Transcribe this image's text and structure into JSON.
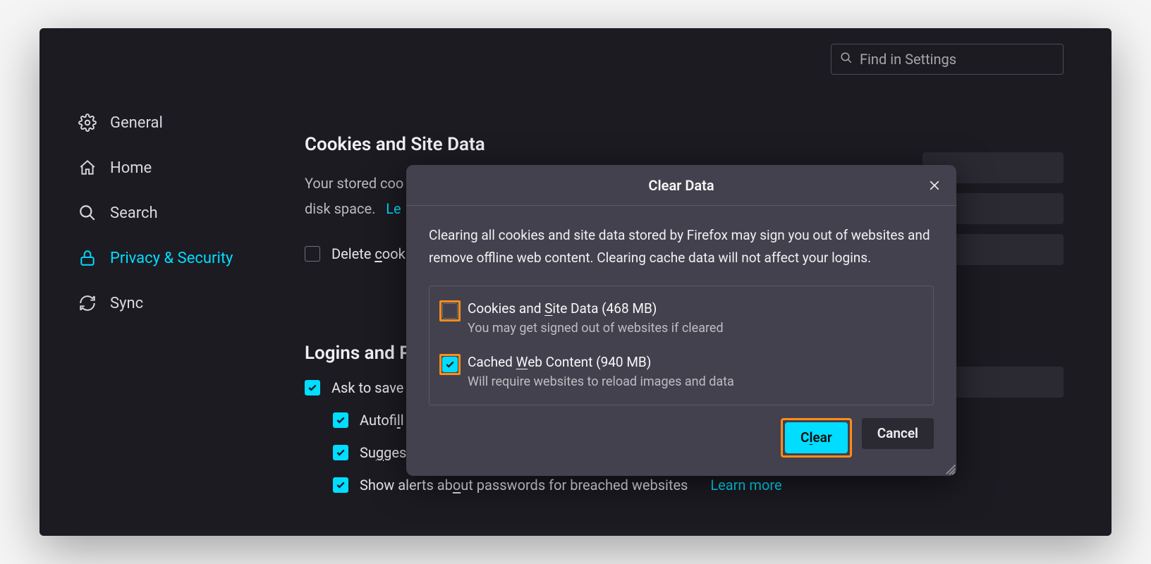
{
  "search": {
    "placeholder": "Find in Settings"
  },
  "sidebar": {
    "general": "General",
    "home": "Home",
    "search": "Search",
    "privacy": "Privacy & Security",
    "sync": "Sync"
  },
  "content": {
    "cookies_heading": "Cookies and Site Data",
    "cookies_body_part1": "Your stored coo",
    "cookies_body_part2": "disk space.",
    "cookies_body_link": "Le",
    "delete_cookies_label_part": "Delete cook",
    "delete_cookies_underline": "c",
    "logins_heading_part": "Logins and P",
    "ask_save_label_part": "Ask to save",
    "autofill_label_pre": "Autofi",
    "autofill_label_underline": "l",
    "autofill_label_post": "l",
    "suggest_label_pre": "Su",
    "suggest_label_underline": "g",
    "suggest_label_post": "gest",
    "breached_label_pre": "Show alerts ab",
    "breached_label_underline": "o",
    "breached_label_post": "ut passwords for breached websites",
    "learn_more": "Learn more"
  },
  "modal": {
    "title": "Clear Data",
    "description": "Clearing all cookies and site data stored by Firefox may sign you out of websites and remove offline web content. Clearing cache data will not affect your logins.",
    "option1_pre": "Cookies and ",
    "option1_underline": "S",
    "option1_post": "ite Data (468 MB)",
    "option1_sub": "You may get signed out of websites if cleared",
    "option2_pre": "Cached ",
    "option2_underline": "W",
    "option2_post": "eb Content (940 MB)",
    "option2_sub": "Will require websites to reload images and data",
    "clear_pre": "C",
    "clear_underline": "l",
    "clear_post": "ear",
    "cancel": "Cancel"
  }
}
